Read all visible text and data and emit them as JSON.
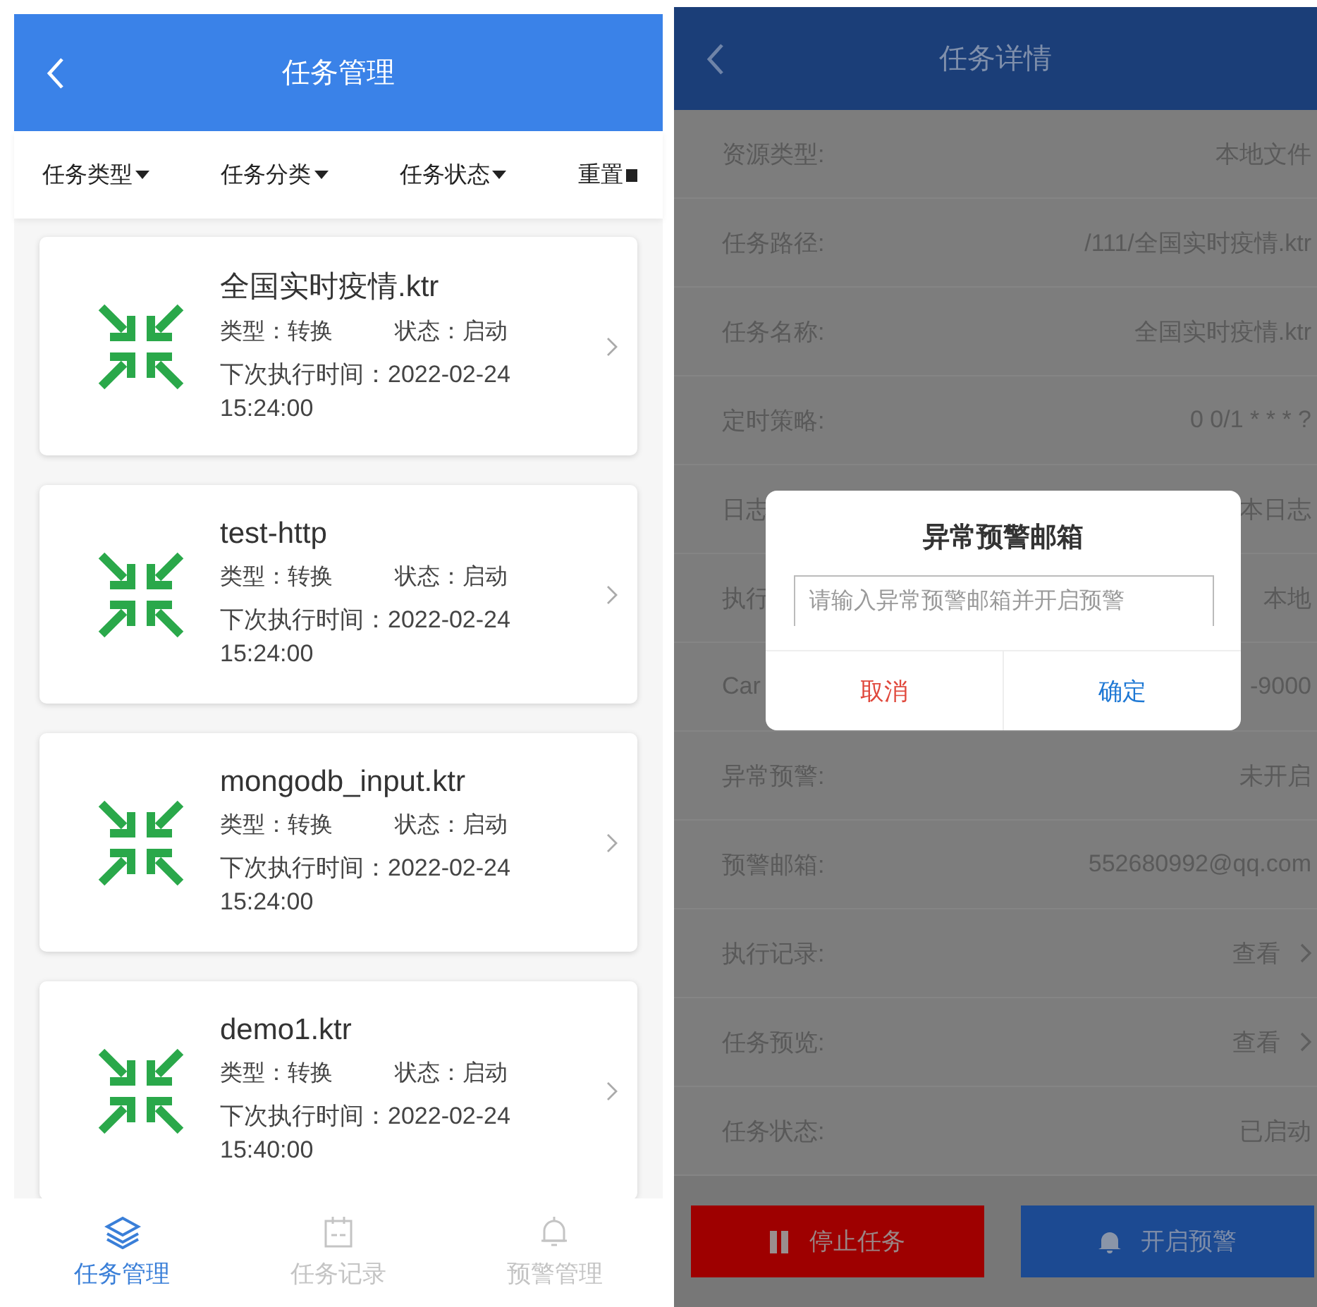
{
  "task_list_screen": {
    "header": {
      "title": "任务管理"
    },
    "filters": [
      {
        "label": "任务类型",
        "kind": "dropdown"
      },
      {
        "label": "任务分类",
        "kind": "dropdown"
      },
      {
        "label": "任务状态",
        "kind": "dropdown"
      },
      {
        "label": "重置",
        "kind": "reset"
      }
    ],
    "tasks": [
      {
        "name": "全国实时疫情.ktr",
        "type": "类型：转换",
        "status": "状态：启动",
        "next_run": "下次执行时间：2022-02-24 15:24:00"
      },
      {
        "name": "test-http",
        "type": "类型：转换",
        "status": "状态：启动",
        "next_run": "下次执行时间：2022-02-24 15:24:00"
      },
      {
        "name": "mongodb_input.ktr",
        "type": "类型：转换",
        "status": "状态：启动",
        "next_run": "下次执行时间：2022-02-24 15:24:00"
      },
      {
        "name": "demo1.ktr",
        "type": "类型：转换",
        "status": "状态：启动",
        "next_run": "下次执行时间：2022-02-24 15:40:00"
      }
    ],
    "tab_bar": [
      {
        "label": "任务管理",
        "kind": "layers",
        "selected": true
      },
      {
        "label": "任务记录",
        "kind": "calendar",
        "selected": false
      },
      {
        "label": "预警管理",
        "kind": "bell",
        "selected": false
      }
    ]
  },
  "task_detail_screen": {
    "header": {
      "title": "任务详情"
    },
    "fields": [
      {
        "label": "资源类型:",
        "value": "本地文件",
        "kind": "text"
      },
      {
        "label": "任务路径:",
        "value": "/111/全国实时疫情.ktr",
        "kind": "text"
      },
      {
        "label": "任务名称:",
        "value": "全国实时疫情.ktr",
        "kind": "text"
      },
      {
        "label": "定时策略:",
        "value": "0 0/1 * * * ?",
        "kind": "text"
      },
      {
        "label": "日志",
        "value": "本日志",
        "kind": "text"
      },
      {
        "label": "执行",
        "value": "本地",
        "kind": "text"
      },
      {
        "label": "Car",
        "value": "-9000",
        "kind": "text"
      },
      {
        "label": "异常预警:",
        "value": "未开启",
        "kind": "text"
      },
      {
        "label": "预警邮箱:",
        "value": "552680992@qq.com",
        "kind": "text"
      },
      {
        "label": "执行记录:",
        "value": "查看",
        "kind": "link"
      },
      {
        "label": "任务预览:",
        "value": "查看",
        "kind": "link"
      },
      {
        "label": "任务状态:",
        "value": "已启动",
        "kind": "text"
      }
    ],
    "actions": [
      {
        "label": "停止任务",
        "kind": "stop"
      },
      {
        "label": "开启预警",
        "kind": "alert"
      }
    ],
    "dialog": {
      "title": "异常预警邮箱",
      "placeholder": "请输入异常预警邮箱并开启预警",
      "cancel": "取消",
      "confirm": "确定"
    }
  }
}
